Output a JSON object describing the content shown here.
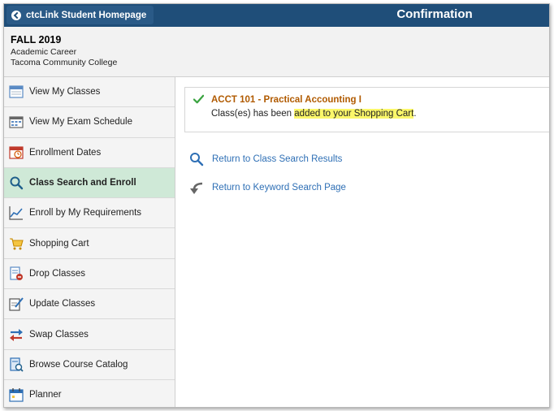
{
  "header": {
    "back_label": "ctcLink Student Homepage",
    "title": "Confirmation"
  },
  "context": {
    "term": "FALL 2019",
    "career": "Academic Career",
    "institution": "Tacoma Community College"
  },
  "sidebar": {
    "items": [
      {
        "label": "View My Classes",
        "icon": "calendar-icon"
      },
      {
        "label": "View My Exam Schedule",
        "icon": "exam-calendar-icon"
      },
      {
        "label": "Enrollment Dates",
        "icon": "clock-calendar-icon"
      },
      {
        "label": "Class Search and Enroll",
        "icon": "search-icon",
        "active": true
      },
      {
        "label": "Enroll by My Requirements",
        "icon": "trend-chart-icon"
      },
      {
        "label": "Shopping Cart",
        "icon": "shopping-cart-icon"
      },
      {
        "label": "Drop Classes",
        "icon": "drop-doc-icon"
      },
      {
        "label": "Update Classes",
        "icon": "edit-doc-icon"
      },
      {
        "label": "Swap Classes",
        "icon": "swap-arrows-icon"
      },
      {
        "label": "Browse Course Catalog",
        "icon": "catalog-icon"
      },
      {
        "label": "Planner",
        "icon": "planner-icon"
      }
    ]
  },
  "confirmation": {
    "course": "ACCT  101 - Practical Accounting I",
    "status_prefix": "Class(es) has been ",
    "status_highlight": "added to your Shopping Cart",
    "status_suffix": "."
  },
  "links": {
    "class_search": "Return to Class Search Results",
    "keyword_search": "Return to Keyword Search Page"
  },
  "colors": {
    "header_bg": "#1f4e79",
    "active_nav_bg": "#cfe9d7",
    "course_text": "#b05a00",
    "link_text": "#2e6fb5",
    "highlight": "#fbf76a",
    "check": "#3aa340"
  }
}
